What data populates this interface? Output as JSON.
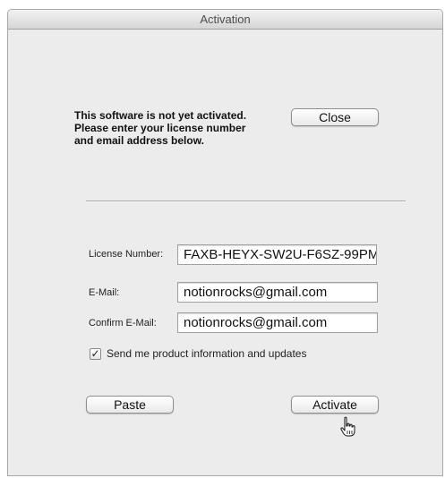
{
  "window": {
    "title": "Activation"
  },
  "message": "This software is not yet activated. Please enter your license number and email address below.",
  "buttons": {
    "close": "Close",
    "paste": "Paste",
    "activate": "Activate"
  },
  "form": {
    "license_label": "License Number:",
    "license_value": "FAXB-HEYX-SW2U-F6SZ-99PM",
    "email_label": "E-Mail:",
    "email_value": "notionrocks@gmail.com",
    "confirm_label": "Confirm E-Mail:",
    "confirm_value": "notionrocks@gmail.com",
    "newsletter_label": "Send me product information and updates",
    "newsletter_checked": true
  },
  "icons": {
    "checkmark": "check-icon",
    "cursor": "hand-pointer-icon"
  }
}
